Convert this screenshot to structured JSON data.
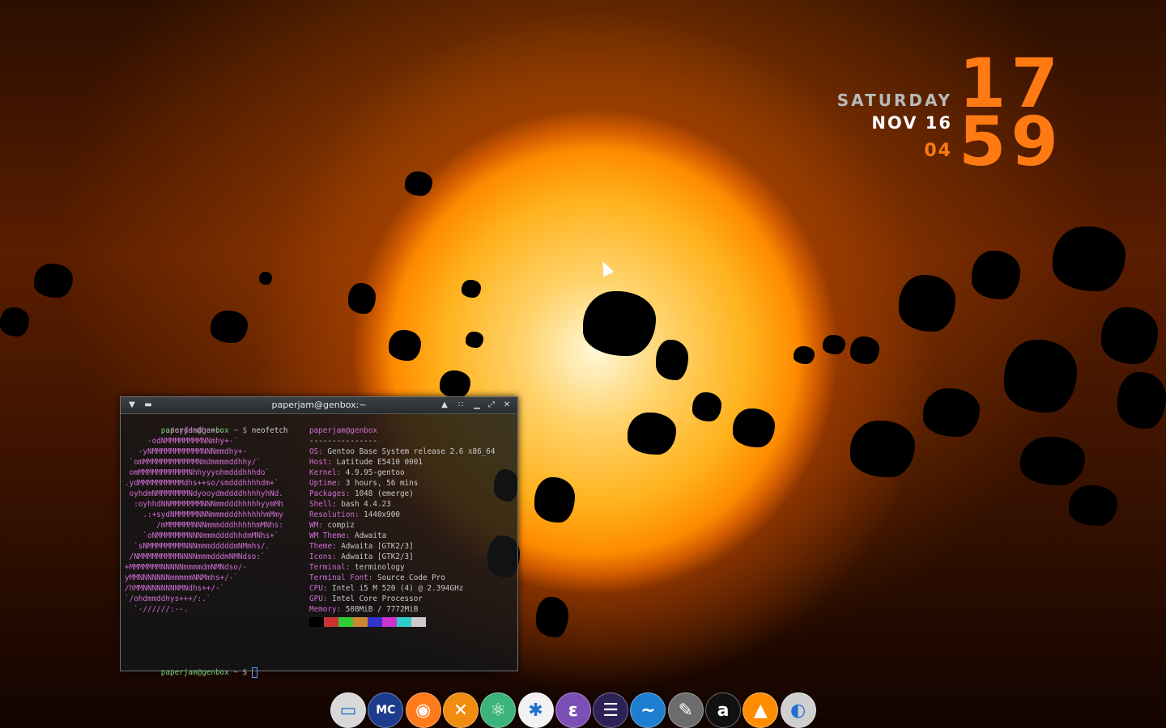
{
  "clock": {
    "day": "SATURDAY",
    "date": "NOV 16",
    "seconds": "04",
    "hour": "17",
    "minute": "59"
  },
  "terminal": {
    "title": "paperjam@genbox:~",
    "prompt_user": "paperjam@genbox",
    "prompt_suffix": " ~ $ ",
    "command": "neofetch",
    "logo_lines": [
      "         -/oyddmdhs+:.",
      "     -odNMMMMMMMMNNmhy+-`",
      "   -yNMMMMMMMMMMMNNNmmdhy+-",
      " `omMMMMMMMMMMMMNmdmmmmddhhy/`",
      " omMMMMMMMMMMMNhhyyyohmdddhhhdo`",
      ".ydMMMMMMMMMMdhs++so/smdddhhhhdm+`",
      " oyhdmNMMMMMMMNdyooydmddddhhhhyhNd.",
      "  :oyhhdNNMMMMMMMNNNmmdddhhhhhyymMh",
      "    .:+sydNMMMMMNNNmmmdddhhhhhhmMmy",
      "       /mMMMMMMNNNmmmdddhhhhhmMNhs:",
      "    `oNMMMMMMMNNNmmmddddhhdmMNhs+`",
      "  `sNMMMMMMMMNNNmmmdddddmNMmhs/.",
      " /NMMMMMMMMMNNNNmmmdddmNMNdso:`",
      "+MMMMMMMNNNNNmmmmdmNMNdso/-",
      "yMMNNNNNNNmmmmmNNMmhs+/-`",
      "/hMMNNNNNNNNMNdhs++/-`",
      "`/ohdmmddhys+++/:.`",
      "  `-//////:--."
    ],
    "info_header": "paperjam@genbox",
    "info_divider": "---------------",
    "info": [
      {
        "label": "OS",
        "value": "Gentoo Base System release 2.6 x86_64"
      },
      {
        "label": "Host",
        "value": "Latitude E5410 0001"
      },
      {
        "label": "Kernel",
        "value": "4.9.95-gentoo"
      },
      {
        "label": "Uptime",
        "value": "3 hours, 56 mins"
      },
      {
        "label": "Packages",
        "value": "1048 (emerge)"
      },
      {
        "label": "Shell",
        "value": "bash 4.4.23"
      },
      {
        "label": "Resolution",
        "value": "1440x900"
      },
      {
        "label": "WM",
        "value": "compiz"
      },
      {
        "label": "WM Theme",
        "value": "Adwaita"
      },
      {
        "label": "Theme",
        "value": "Adwaita [GTK2/3]"
      },
      {
        "label": "Icons",
        "value": "Adwaita [GTK2/3]"
      },
      {
        "label": "Terminal",
        "value": "terminology"
      },
      {
        "label": "Terminal Font",
        "value": "Source Code Pro"
      },
      {
        "label": "CPU",
        "value": "Intel i5 M 520 (4) @ 2.394GHz"
      },
      {
        "label": "GPU",
        "value": "Intel Core Processor"
      },
      {
        "label": "Memory",
        "value": "508MiB / 7772MiB"
      }
    ],
    "palette": [
      "#000000",
      "#cc3333",
      "#33cc33",
      "#cc8833",
      "#3333cc",
      "#cc33cc",
      "#33cccc",
      "#cccccc"
    ]
  },
  "dock": {
    "items": [
      {
        "name": "terminal-app-icon",
        "glyph": "▭",
        "color": "#d8d8d8"
      },
      {
        "name": "midnight-commander-icon",
        "glyph": "MC",
        "color": "#1d3c8c"
      },
      {
        "name": "firefox-icon",
        "glyph": "◉",
        "color": "#ff7a1a"
      },
      {
        "name": "xfce-settings-icon",
        "glyph": "✕",
        "color": "#f08c10"
      },
      {
        "name": "atom-editor-icon",
        "glyph": "⚛",
        "color": "#3bb37a"
      },
      {
        "name": "coral-app-icon",
        "glyph": "✱",
        "color": "#f2f2f2"
      },
      {
        "name": "emacs-icon",
        "glyph": "ε",
        "color": "#7b4fb5"
      },
      {
        "name": "eclipse-icon",
        "glyph": "☰",
        "color": "#2c2255"
      },
      {
        "name": "libreoffice-writer-icon",
        "glyph": "~",
        "color": "#1e7fd0"
      },
      {
        "name": "gimp-icon",
        "glyph": "✎",
        "color": "#6c6c6c"
      },
      {
        "name": "audacity-icon",
        "glyph": "a",
        "color": "#111111"
      },
      {
        "name": "vlc-icon",
        "glyph": "▲",
        "color": "#ff8c00"
      },
      {
        "name": "network-manager-icon",
        "glyph": "◐",
        "color": "#cfcfcf"
      }
    ]
  }
}
